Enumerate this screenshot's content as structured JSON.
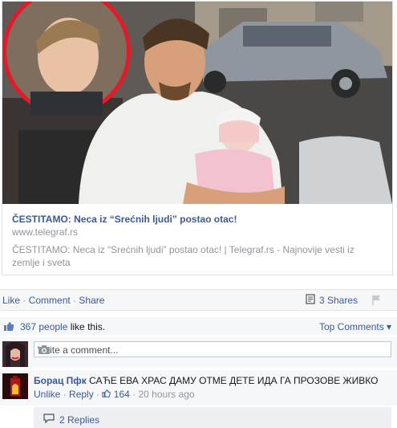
{
  "link_preview": {
    "title": "ČESTITAMO: Neca iz “Srećnih ljudi” postao otac!",
    "domain": "www.telegraf.rs",
    "description": "ČESTITAMO: Neca iz “Srećnih ljudi” postao otac! | Telegraf.rs - Najnovije vesti iz zemlje i sveta"
  },
  "actions": {
    "like": "Like",
    "comment": "Comment",
    "share": "Share",
    "separator": "·",
    "shares": "3 Shares"
  },
  "likes": {
    "count_text": "367 people",
    "suffix": " like this.",
    "top_comments": "Top Comments"
  },
  "write_comment": {
    "placeholder": "Write a comment..."
  },
  "comment": {
    "author": "Борац Пфк",
    "text": "САЋЕ ЕВА ХРАС ДАМУ ОТМЕ ДЕТЕ ИДА ГА ПРОЗОВЕ ЖИВКО",
    "unlike": "Unlike",
    "reply": "Reply",
    "like_count": "164",
    "time": "20 hours ago",
    "replies": "2 Replies"
  },
  "colors": {
    "link": "#3b5998",
    "muted": "#90949c",
    "panel": "#f6f7f9",
    "highlight_ring": "#e4192a"
  },
  "icons": [
    "share-icon",
    "flag-icon",
    "thumbs-up-icon",
    "camera-icon",
    "reply-bubble-icon"
  ]
}
